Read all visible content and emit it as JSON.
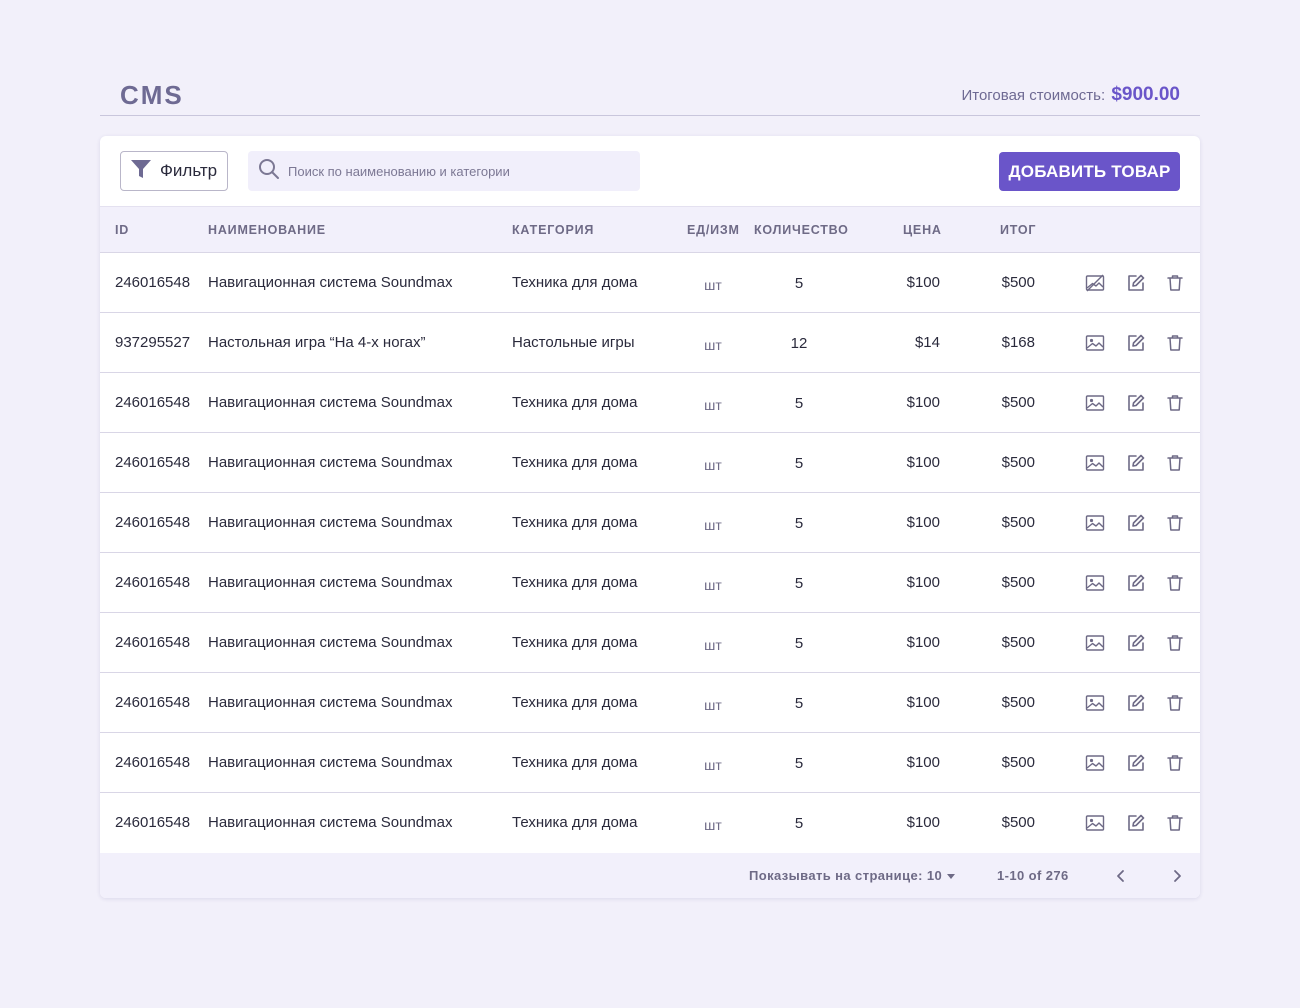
{
  "header": {
    "title": "CMS",
    "total_label": "Итоговая стоимость:",
    "total_value": "$900.00"
  },
  "toolbar": {
    "filter_label": "Фильтр",
    "search_placeholder": "Поиск по наименованию и категории",
    "search_value": "",
    "add_label": "ДОБАВИТЬ ТОВАР"
  },
  "table": {
    "columns": [
      "ID",
      "НАИМЕНОВАНИЕ",
      "КАТЕГОРИЯ",
      "ЕД/ИЗМ",
      "КОЛИЧЕСТВО",
      "ЦЕНА",
      "ИТОГ"
    ],
    "rows": [
      {
        "id": "246016548",
        "name": "Навигационная система Soundmax",
        "category": "Техника для дома",
        "unit": "шт",
        "qty": "5",
        "price": "$100",
        "sum": "$500",
        "has_image": false
      },
      {
        "id": "937295527",
        "name": "Настольная игра “На 4-х ногах”",
        "category": "Настольные игры",
        "unit": "шт",
        "qty": "12",
        "price": "$14",
        "sum": "$168",
        "has_image": true
      },
      {
        "id": "246016548",
        "name": "Навигационная система Soundmax",
        "category": "Техника для дома",
        "unit": "шт",
        "qty": "5",
        "price": "$100",
        "sum": "$500",
        "has_image": true
      },
      {
        "id": "246016548",
        "name": "Навигационная система Soundmax",
        "category": "Техника для дома",
        "unit": "шт",
        "qty": "5",
        "price": "$100",
        "sum": "$500",
        "has_image": true
      },
      {
        "id": "246016548",
        "name": "Навигационная система Soundmax",
        "category": "Техника для дома",
        "unit": "шт",
        "qty": "5",
        "price": "$100",
        "sum": "$500",
        "has_image": true
      },
      {
        "id": "246016548",
        "name": "Навигационная система Soundmax",
        "category": "Техника для дома",
        "unit": "шт",
        "qty": "5",
        "price": "$100",
        "sum": "$500",
        "has_image": true
      },
      {
        "id": "246016548",
        "name": "Навигационная система Soundmax",
        "category": "Техника для дома",
        "unit": "шт",
        "qty": "5",
        "price": "$100",
        "sum": "$500",
        "has_image": true
      },
      {
        "id": "246016548",
        "name": "Навигационная система Soundmax",
        "category": "Техника для дома",
        "unit": "шт",
        "qty": "5",
        "price": "$100",
        "sum": "$500",
        "has_image": true
      },
      {
        "id": "246016548",
        "name": "Навигационная система Soundmax",
        "category": "Техника для дома",
        "unit": "шт",
        "qty": "5",
        "price": "$100",
        "sum": "$500",
        "has_image": true
      },
      {
        "id": "246016548",
        "name": "Навигационная система Soundmax",
        "category": "Техника для дома",
        "unit": "шт",
        "qty": "5",
        "price": "$100",
        "sum": "$500",
        "has_image": true
      }
    ]
  },
  "footer": {
    "per_page_label": "Показывать на странице: 10",
    "range_label": "1-10 of 276"
  },
  "icons": {
    "filter": "filter-icon",
    "search": "search-icon",
    "image": "image-icon",
    "no_image": "image-off-icon",
    "edit": "edit-icon",
    "delete": "trash-icon",
    "prev": "chevron-left-icon",
    "next": "chevron-right-icon"
  },
  "colors": {
    "accent": "#6a55c9",
    "background": "#f2f0fa",
    "muted_text": "#6e6a86"
  }
}
